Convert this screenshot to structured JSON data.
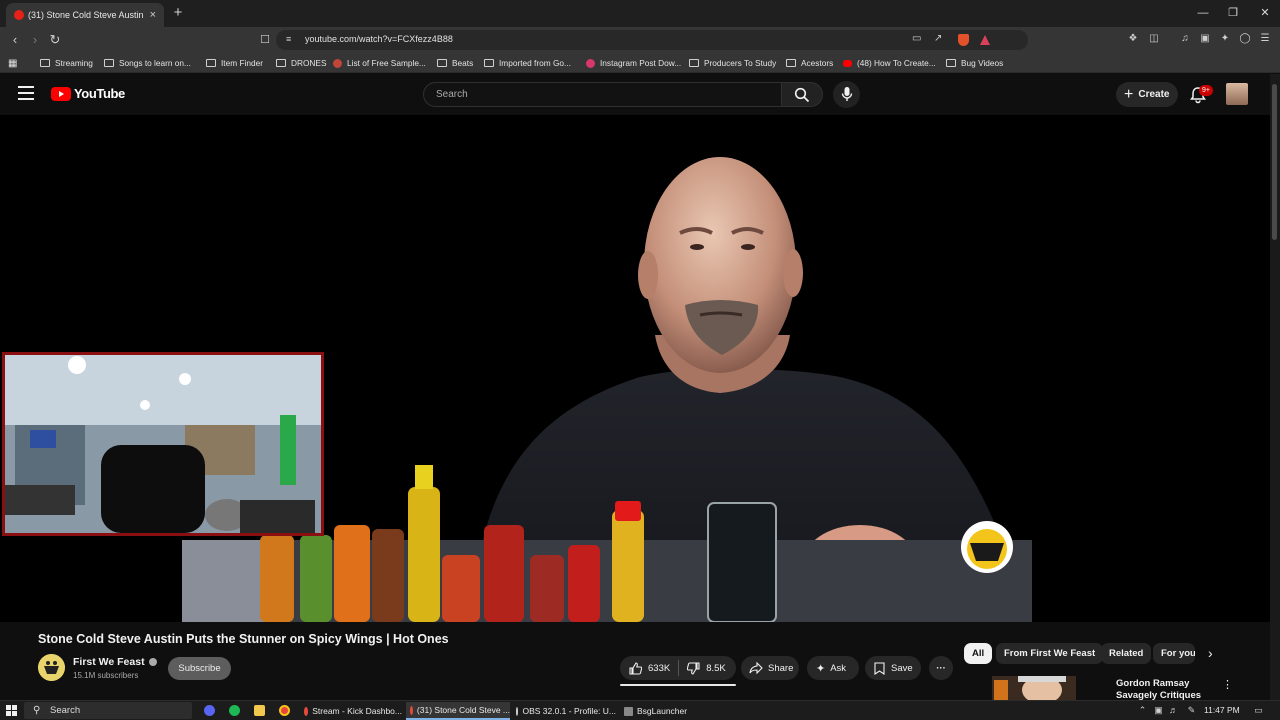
{
  "browser": {
    "tab": {
      "title": "(31) Stone Cold Steve Austin Put...",
      "close": "×"
    },
    "new_tab": "+",
    "url": "youtube.com/watch?v=FCXfezz4B88",
    "bookmarks": [
      {
        "label": "Streaming",
        "icon": "folder-icon"
      },
      {
        "label": "Songs to learn on...",
        "icon": "folder-icon"
      },
      {
        "label": "Item Finder",
        "icon": "folder-icon"
      },
      {
        "label": "DRONES",
        "icon": "folder-icon"
      },
      {
        "label": "List of Free Sample...",
        "icon": "site-icon"
      },
      {
        "label": "Beats",
        "icon": "folder-icon"
      },
      {
        "label": "Imported from Go...",
        "icon": "folder-icon"
      },
      {
        "label": "Instagram Post Dow...",
        "icon": "site-icon"
      },
      {
        "label": "Producers To Study",
        "icon": "folder-icon"
      },
      {
        "label": "Acestors",
        "icon": "folder-icon"
      },
      {
        "label": "(48) How To Create...",
        "icon": "youtube-icon"
      },
      {
        "label": "Bug Videos",
        "icon": "folder-icon"
      }
    ]
  },
  "youtube": {
    "logo_text": "YouTube",
    "search_placeholder": "Search",
    "create_label": "Create",
    "notification_badge": "9+",
    "video": {
      "title": "Stone Cold Steve Austin Puts the Stunner on Spicy Wings | Hot Ones",
      "channel": "First We Feast",
      "subscribers": "15.1M subscribers",
      "subscribe_label": "Subscribe",
      "likes": "633K",
      "dislikes": "8.5K",
      "share_label": "Share",
      "ask_label": "Ask",
      "save_label": "Save",
      "more": "···"
    },
    "chips": [
      "All",
      "From First We Feast",
      "Related",
      "For you"
    ],
    "recommended": {
      "title": "Gordon Ramsay Savagely Critiques"
    }
  },
  "taskbar": {
    "search_label": "Search",
    "apps": [
      {
        "label": "Stream - Kick Dashbo...",
        "color": "#e34b3b",
        "active": false
      },
      {
        "label": "(31) Stone Cold Steve ...",
        "color": "#e34b3b",
        "active": true
      },
      {
        "label": "OBS 32.0.1 - Profile: U...",
        "color": "#cccccc",
        "active": false
      },
      {
        "label": "BsgLauncher",
        "color": "#888888",
        "active": false
      }
    ],
    "clock": "11:47 PM"
  },
  "colors": {
    "accent_red": "#ff0000",
    "webcam_border": "#8a0f12",
    "chip_active_bg": "#f1f1f1"
  }
}
